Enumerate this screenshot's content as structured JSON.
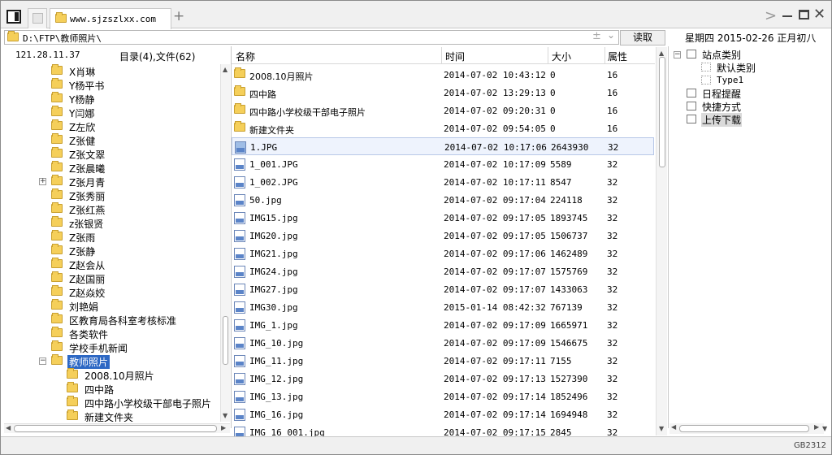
{
  "titlebar": {
    "tab_title": "www.sjzszlxx.com",
    "new_tab": "+",
    "forward": ">",
    "close": "✕"
  },
  "address": {
    "path": "D:\\FTP\\教师照片\\",
    "plus": "±",
    "dropdown": "⌄",
    "read_label": "读取",
    "date": "星期四 2015-02-26 正月初八"
  },
  "info": {
    "ip": "121.28.11.37",
    "dir_count": "目录(4),文件(62)"
  },
  "tree": {
    "items": [
      {
        "label": "X肖琳"
      },
      {
        "label": "Y杨平书"
      },
      {
        "label": "Y杨静"
      },
      {
        "label": "Y闫娜"
      },
      {
        "label": "Z左欣"
      },
      {
        "label": "Z张健"
      },
      {
        "label": "Z张文翠"
      },
      {
        "label": "Z张晨曦"
      },
      {
        "label": "Z张月青",
        "expander": "+"
      },
      {
        "label": "Z张秀丽"
      },
      {
        "label": "Z张红燕"
      },
      {
        "label": "z张银贤"
      },
      {
        "label": "Z张雨"
      },
      {
        "label": "Z张静"
      },
      {
        "label": "Z赵会从"
      },
      {
        "label": "Z赵国丽"
      },
      {
        "label": "Z赵焱姣"
      },
      {
        "label": "刘艳娟"
      },
      {
        "label": "区教育局各科室考核标准"
      },
      {
        "label": "各类软件"
      },
      {
        "label": "学校手机新闻"
      },
      {
        "label": "教师照片",
        "expander": "−",
        "selected": true
      },
      {
        "label": "2008.10月照片",
        "child": true
      },
      {
        "label": "四中路",
        "child": true
      },
      {
        "label": "四中路小学校级干部电子照片",
        "child": true
      },
      {
        "label": "新建文件夹",
        "child": true
      }
    ]
  },
  "files": {
    "columns": {
      "name": "名称",
      "time": "时间",
      "size": "大小",
      "attr": "属性"
    },
    "rows": [
      {
        "name": "2008.10月照片",
        "time": "2014-07-02 10:43:12",
        "size": "0",
        "attr": "16",
        "type": "folder"
      },
      {
        "name": "四中路",
        "time": "2014-07-02 13:29:13",
        "size": "0",
        "attr": "16",
        "type": "folder"
      },
      {
        "name": "四中路小学校级干部电子照片",
        "time": "2014-07-02 09:20:31",
        "size": "0",
        "attr": "16",
        "type": "folder"
      },
      {
        "name": "新建文件夹",
        "time": "2014-07-02 09:54:05",
        "size": "0",
        "attr": "16",
        "type": "folder"
      },
      {
        "name": "1.JPG",
        "time": "2014-07-02 10:17:06",
        "size": "2643930",
        "attr": "32",
        "type": "file",
        "selected": true
      },
      {
        "name": "1_001.JPG",
        "time": "2014-07-02 10:17:09",
        "size": "5589",
        "attr": "32",
        "type": "file"
      },
      {
        "name": "1_002.JPG",
        "time": "2014-07-02 10:17:11",
        "size": "8547",
        "attr": "32",
        "type": "file"
      },
      {
        "name": "50.jpg",
        "time": "2014-07-02 09:17:04",
        "size": "224118",
        "attr": "32",
        "type": "file"
      },
      {
        "name": "IMG15.jpg",
        "time": "2014-07-02 09:17:05",
        "size": "1893745",
        "attr": "32",
        "type": "file"
      },
      {
        "name": "IMG20.jpg",
        "time": "2014-07-02 09:17:05",
        "size": "1506737",
        "attr": "32",
        "type": "file"
      },
      {
        "name": "IMG21.jpg",
        "time": "2014-07-02 09:17:06",
        "size": "1462489",
        "attr": "32",
        "type": "file"
      },
      {
        "name": "IMG24.jpg",
        "time": "2014-07-02 09:17:07",
        "size": "1575769",
        "attr": "32",
        "type": "file"
      },
      {
        "name": "IMG27.jpg",
        "time": "2014-07-02 09:17:07",
        "size": "1433063",
        "attr": "32",
        "type": "file"
      },
      {
        "name": "IMG30.jpg",
        "time": "2015-01-14 08:42:32",
        "size": "767139",
        "attr": "32",
        "type": "file"
      },
      {
        "name": "IMG_1.jpg",
        "time": "2014-07-02 09:17:09",
        "size": "1665971",
        "attr": "32",
        "type": "file"
      },
      {
        "name": "IMG_10.jpg",
        "time": "2014-07-02 09:17:09",
        "size": "1546675",
        "attr": "32",
        "type": "file"
      },
      {
        "name": "IMG_11.jpg",
        "time": "2014-07-02 09:17:11",
        "size": "7155",
        "attr": "32",
        "type": "file"
      },
      {
        "name": "IMG_12.jpg",
        "time": "2014-07-02 09:17:13",
        "size": "1527390",
        "attr": "32",
        "type": "file"
      },
      {
        "name": "IMG_13.jpg",
        "time": "2014-07-02 09:17:14",
        "size": "1852496",
        "attr": "32",
        "type": "file"
      },
      {
        "name": "IMG_16.jpg",
        "time": "2014-07-02 09:17:14",
        "size": "1694948",
        "attr": "32",
        "type": "file"
      },
      {
        "name": "IMG_16_001.jpg",
        "time": "2014-07-02 09:17:15",
        "size": "2845",
        "attr": "32",
        "type": "file"
      }
    ]
  },
  "site_tree": {
    "items": [
      {
        "label": "站点类别",
        "expander": "−"
      },
      {
        "label": "默认类别",
        "child": true
      },
      {
        "label": "Type1",
        "child": true,
        "small": true
      },
      {
        "label": "日程提醒"
      },
      {
        "label": "快捷方式"
      },
      {
        "label": "上传下载",
        "selected": true
      }
    ]
  },
  "status": {
    "encoding": "GB2312"
  },
  "icons": {
    "sidebar_toggle": "sidebar-toggle-icon",
    "folder": "folder-icon",
    "image_file": "image-file-icon",
    "minimize": "minimize-icon",
    "maximize": "maximize-icon",
    "close": "close-icon"
  },
  "colors": {
    "selection": "#2d68c4",
    "folder": "#f5cf5a",
    "row_highlight": "#eef3fd"
  }
}
